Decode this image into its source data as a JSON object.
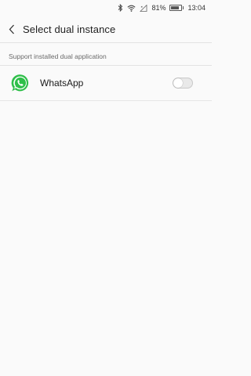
{
  "status_bar": {
    "battery_percent": "81%",
    "battery_level": 0.81,
    "time": "13:04",
    "icons": [
      "bluetooth-icon",
      "wifi-icon",
      "cellular-signal-icon",
      "battery-icon"
    ]
  },
  "header": {
    "back_icon": "chevron-left-icon",
    "title": "Select dual instance"
  },
  "section": {
    "label": "Support installed dual application"
  },
  "apps": [
    {
      "name": "WhatsApp",
      "icon": "whatsapp-icon",
      "dual_enabled": false
    }
  ],
  "colors": {
    "whatsapp_green": "#2fbf4a",
    "background": "#fafafa",
    "toggle_off": "#e9e9e9"
  }
}
